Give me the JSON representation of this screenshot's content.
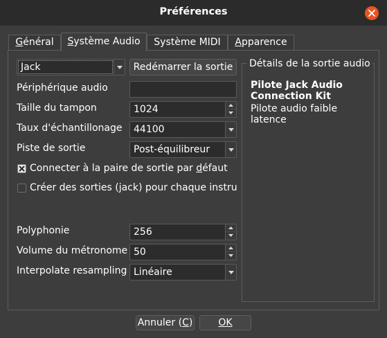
{
  "window": {
    "title": "Préférences"
  },
  "tabs": [
    {
      "pre": "",
      "accel": "G",
      "post": "énéral"
    },
    {
      "pre": "",
      "accel": "S",
      "post": "ystème Audio"
    },
    {
      "pre": "Système MIDI",
      "accel": "",
      "post": ""
    },
    {
      "pre": "",
      "accel": "A",
      "post": "pparence"
    }
  ],
  "audio": {
    "driver": "Jack",
    "restart_button": "Redémarrer la sortie",
    "device_label": "Périphérique audio",
    "device_value": "",
    "buffer_label": "Taille du tampon",
    "buffer_value": "1024",
    "samplerate_label": "Taux d'échantillonage",
    "samplerate_value": "44100",
    "output_track_label": "Piste de sortie",
    "output_track_value": "Post-équilibreur",
    "connect_default_pre": "Connecter à la paire de sortie par ",
    "connect_default_accel": "d",
    "connect_default_post": "éfaut",
    "connect_default_checked": true,
    "per_instrument_label": "Créer des sorties (jack) pour chaque instrume",
    "per_instrument_checked": false,
    "polyphony_label": "Polyphonie",
    "polyphony_value": "256",
    "metronome_label": "Volume du métronome",
    "metronome_value": "50",
    "resampling_label": "Interpolate resampling",
    "resampling_value": "Linéaire"
  },
  "details": {
    "group_title": "Détails de la sortie audio",
    "heading": "Pilote Jack Audio Connection Kit",
    "description": "Pilote audio faible latence"
  },
  "footer": {
    "cancel_pre": "Annuler (",
    "cancel_accel": "C",
    "cancel_post": ")",
    "ok_label": "OK"
  }
}
